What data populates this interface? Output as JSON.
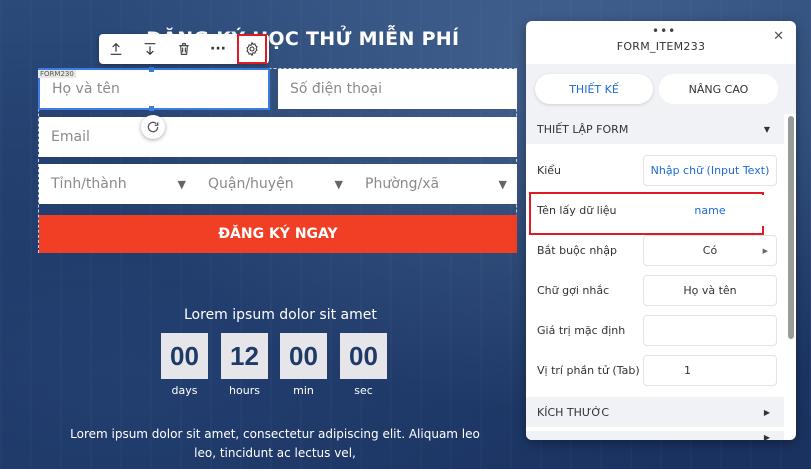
{
  "page": {
    "title": "ĐĂNG KÝ HỌC THỬ MIỄN PHÍ",
    "form_tag": "FORM230",
    "submit_label": "ĐĂNG KÝ NGAY",
    "sub_heading": "Lorem ipsum dolor sit amet",
    "paragraph": "Lorem ipsum dolor sit amet, consectetur adipiscing elit. Aliquam leo leo, tincidunt ac lectus vel,"
  },
  "toolbar": {
    "icons": [
      "move-up-icon",
      "move-down-icon",
      "trash-icon",
      "more-icon",
      "gear-icon"
    ],
    "more_glyph": "···"
  },
  "form": {
    "name_placeholder": "Họ và tên",
    "phone_placeholder": "Số điện thoại",
    "email_placeholder": "Email",
    "province_placeholder": "Tỉnh/thành",
    "district_placeholder": "Quận/huyện",
    "ward_placeholder": "Phường/xã"
  },
  "countdown": [
    {
      "value": "00",
      "label": "days"
    },
    {
      "value": "12",
      "label": "hours"
    },
    {
      "value": "00",
      "label": "min"
    },
    {
      "value": "00",
      "label": "sec"
    }
  ],
  "panel": {
    "title": "FORM_ITEM233",
    "tab_design": "THIẾT KẾ",
    "tab_advanced": "NÂNG CAO",
    "section_form": "THIẾT LẬP FORM",
    "section_size": "KÍCH THƯỚC",
    "rows": [
      {
        "label": "Kiểu",
        "value": "Nhập chữ (Input Text)"
      },
      {
        "label": "Tên lấy dữ liệu",
        "value": "name"
      },
      {
        "label": "Bắt buộc nhập",
        "value": "Có"
      },
      {
        "label": "Chữ gợi nhắc",
        "value": "Họ và tên"
      },
      {
        "label": "Giá trị mặc định",
        "value": ""
      },
      {
        "label": "Vị trí phần tử (Tab)",
        "value": "1"
      }
    ]
  },
  "colors": {
    "accent_blue": "#1e6ad6",
    "submit_orange": "#f03f24",
    "highlight_red": "#e01a22",
    "background_navy": "#1f3a67"
  }
}
